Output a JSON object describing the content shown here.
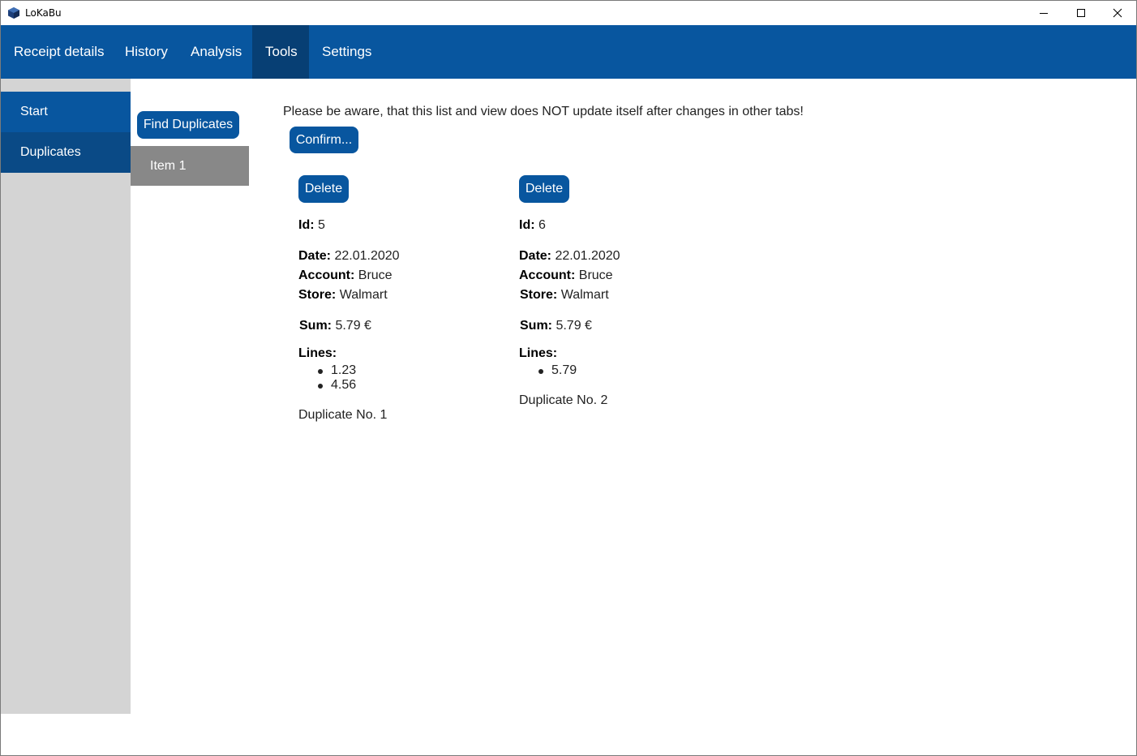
{
  "window": {
    "title": "LoKaBu"
  },
  "nav": {
    "tabs": [
      {
        "label": "Receipt details"
      },
      {
        "label": "History"
      },
      {
        "label": "Analysis"
      },
      {
        "label": "Tools"
      },
      {
        "label": "Settings"
      }
    ],
    "active": "Tools"
  },
  "sidebar": {
    "items": [
      {
        "label": "Start"
      },
      {
        "label": "Duplicates"
      }
    ]
  },
  "duplicates_panel": {
    "find_label": "Find Duplicates",
    "items": [
      {
        "label": "Item 1"
      }
    ]
  },
  "main": {
    "notice": "Please be aware, that this list and view does NOT update itself after changes in other tabs!",
    "confirm_label": "Confirm...",
    "field_labels": {
      "id": "Id:",
      "date": "Date:",
      "account": "Account:",
      "store": "Store:",
      "sum": "Sum:",
      "lines": "Lines:"
    },
    "cards": [
      {
        "delete_label": "Delete",
        "id": "5",
        "date": "22.01.2020",
        "account": "Bruce",
        "store": "Walmart",
        "sum": "5.79 €",
        "lines": [
          "1.23",
          "4.56"
        ],
        "footer": "Duplicate No. 1"
      },
      {
        "delete_label": "Delete",
        "id": "6",
        "date": "22.01.2020",
        "account": "Bruce",
        "store": "Walmart",
        "sum": "5.79 €",
        "lines": [
          "5.79"
        ],
        "footer": "Duplicate No. 2"
      }
    ]
  },
  "colors": {
    "accent": "#08569f",
    "accent_dark": "#073f74",
    "sidebar_bg": "#d4d4d4",
    "item_selected": "#888888"
  }
}
